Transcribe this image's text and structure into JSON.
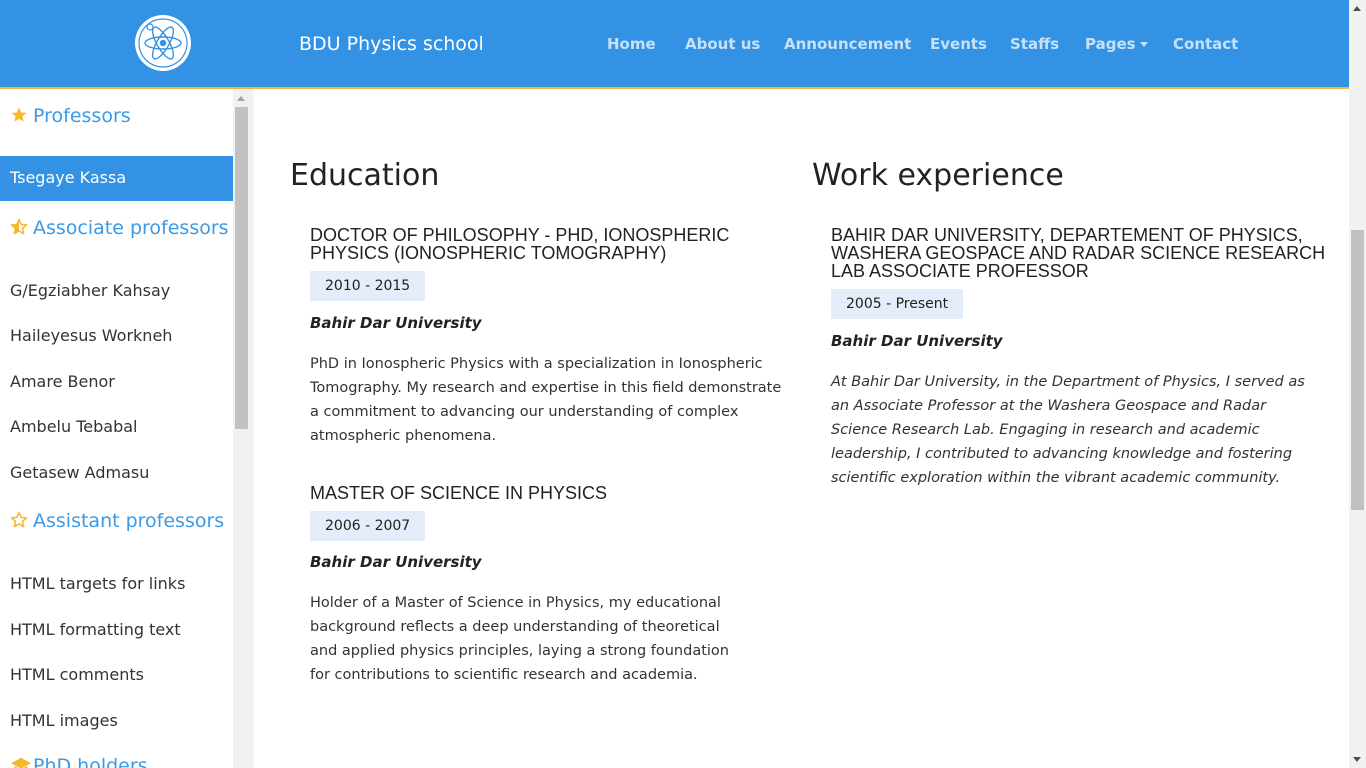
{
  "navbar": {
    "brand": "BDU Physics school",
    "links": [
      "Home",
      "About us",
      "Announcement",
      "Events",
      "Staffs",
      "Pages",
      "Contact"
    ]
  },
  "sidebar": {
    "professors_heading": "Professors",
    "professors": [
      "Tsegaye Kassa"
    ],
    "associate_heading": "Associate professors",
    "associates": [
      "G/Egziabher Kahsay",
      "Haileyesus Workneh",
      "Amare Benor",
      "Ambelu Tebabal",
      "Getasew Admasu"
    ],
    "assistant_heading": "Assistant professors",
    "assistants": [
      "HTML targets for links",
      "HTML formatting text",
      "HTML comments",
      "HTML images"
    ],
    "phd_heading": "PhD holders"
  },
  "education": {
    "title": "Education",
    "entries": [
      {
        "title": "Doctor of Philosophy - PhD, Ionospheric Physics (Ionospheric Tomography)",
        "dates": "2010 - 2015",
        "institution": "Bahir Dar University",
        "description": "PhD in Ionospheric Physics with a specialization in Ionospheric Tomography. My research and expertise in this field demonstrate a commitment to advancing our understanding of complex atmospheric phenomena."
      },
      {
        "title": "Master of Science in Physics",
        "dates": "2006 - 2007",
        "institution": "Bahir Dar University",
        "description": "Holder of a Master of Science in Physics, my educational background reflects a deep understanding of theoretical and applied physics principles, laying a strong foundation for contributions to scientific research and academia."
      }
    ]
  },
  "work": {
    "title": "Work experience",
    "entries": [
      {
        "title": "Bahir Dar University, Departement of physics, Washera Geospace and Radar Science Research Lab Associate Professor",
        "dates": "2005 - Present",
        "institution": "Bahir Dar University",
        "description": "At Bahir Dar University, in the Department of Physics, I served as an Associate Professor at the Washera Geospace and Radar Science Research Lab. Engaging in research and academic leadership, I contributed to advancing knowledge and fostering scientific exploration within the vibrant academic community."
      }
    ]
  },
  "colors": {
    "navbar": "#3392e4",
    "navbar_border": "#f0b93a",
    "sidebar_heading": "#3b9ae6",
    "star": "#f5b82e",
    "date_badge_bg": "#e4edf9"
  }
}
